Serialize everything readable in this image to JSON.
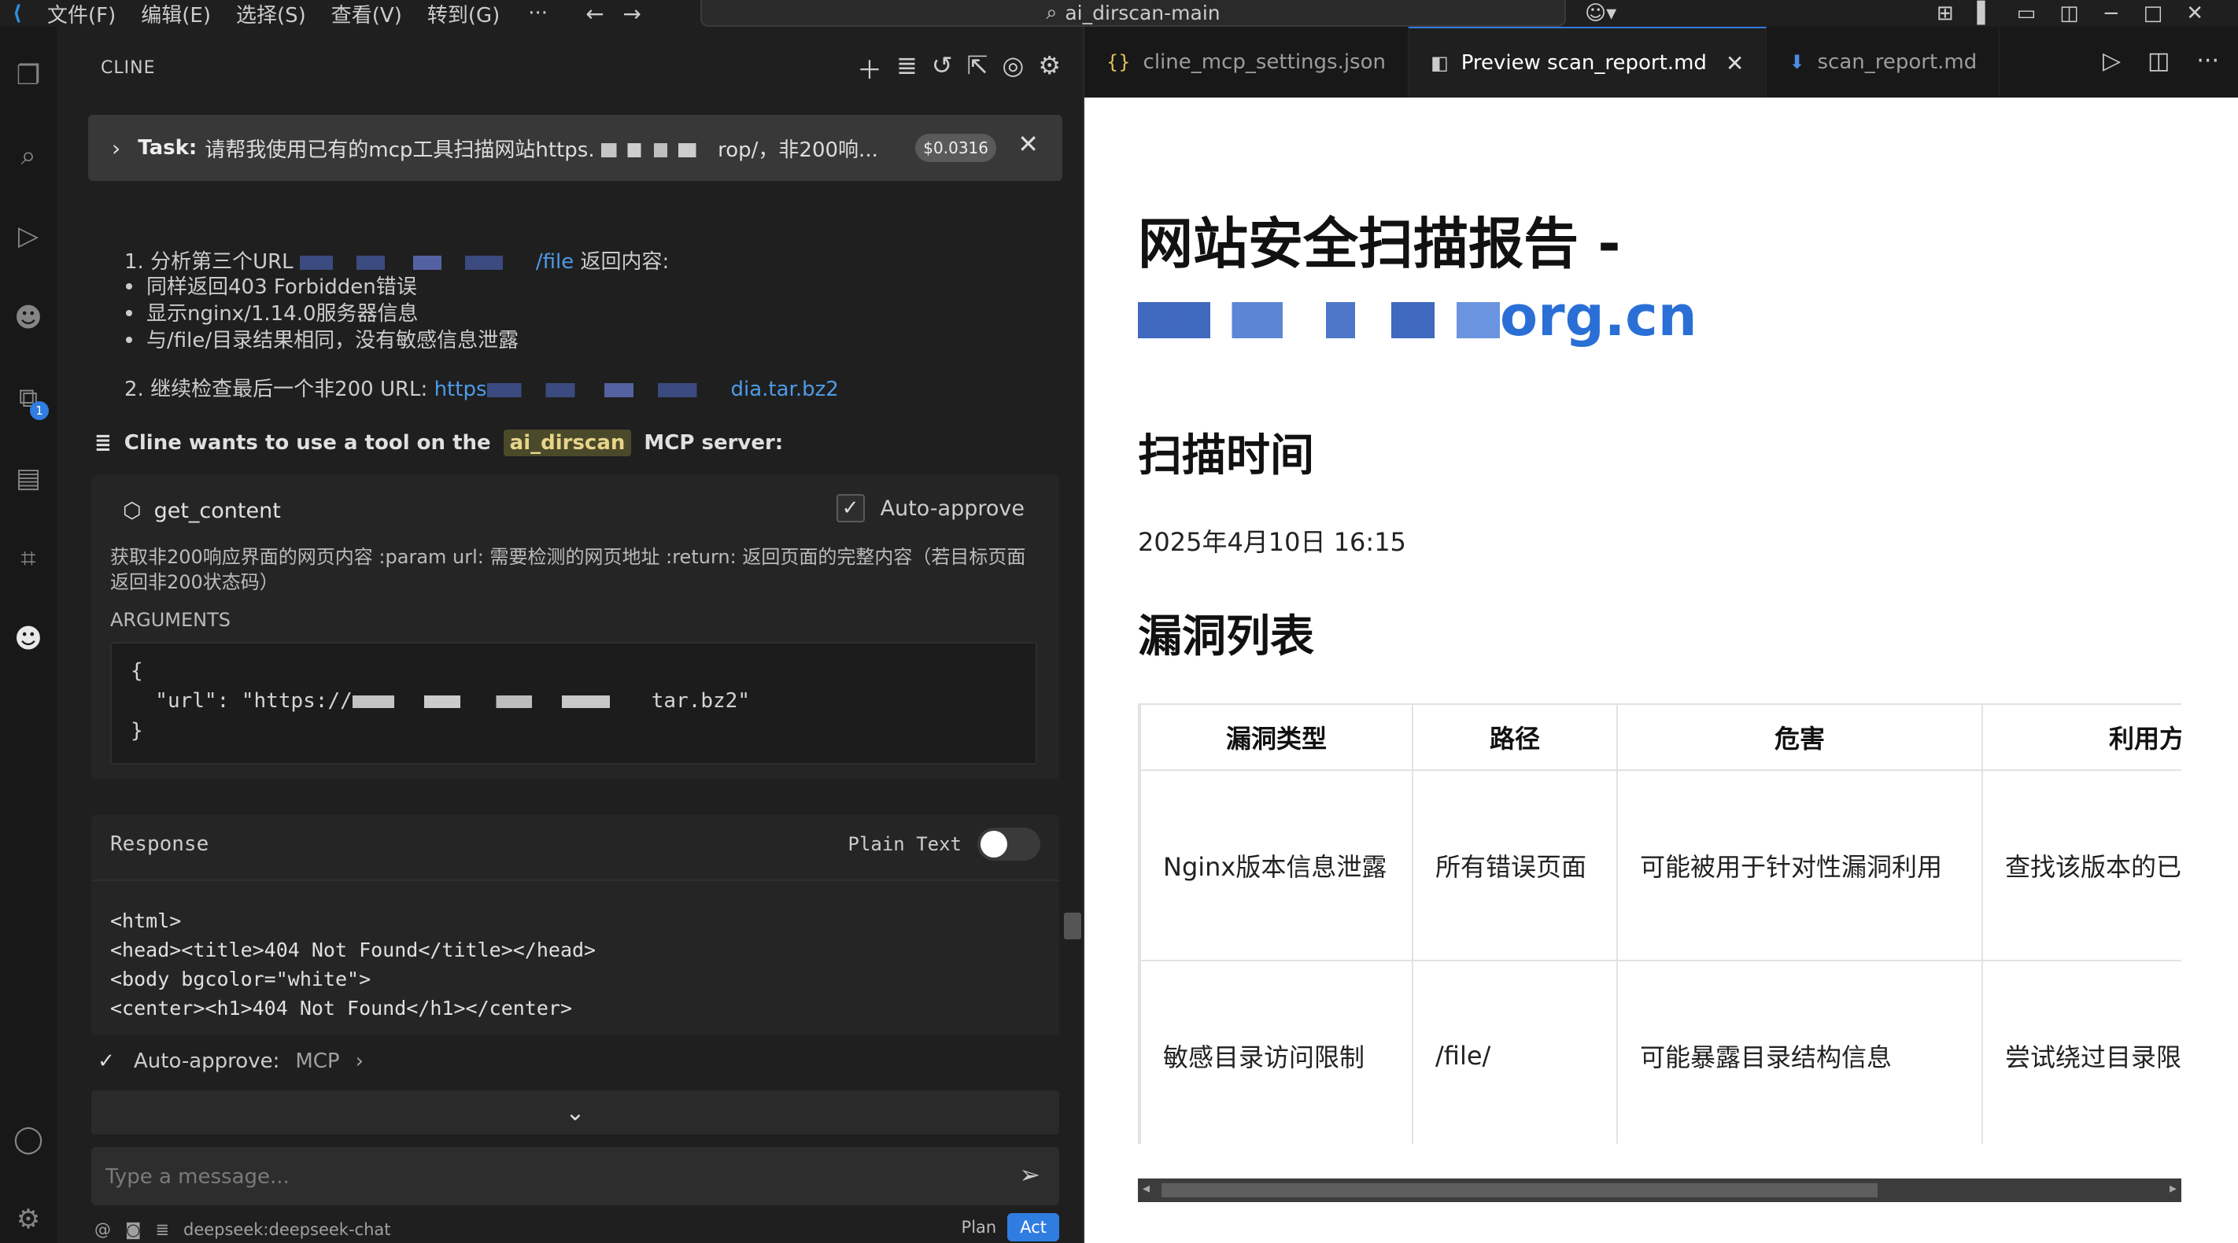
{
  "titlebar": {
    "menu": [
      "文件(F)",
      "编辑(E)",
      "选择(S)",
      "查看(V)",
      "转到(G)"
    ],
    "more": "···",
    "search_text": "ai_dirscan-main"
  },
  "activity": {
    "extensions_badge": "1"
  },
  "cline": {
    "panel_title": "CLINE",
    "task": {
      "label": "Task:",
      "text": "请帮我使用已有的mcp工具扫描网站https.",
      "text_tail": "rop/，非200响...",
      "cost": "$0.0316"
    },
    "step1": {
      "prefix": "1. 分析第三个URL",
      "link_tail": "/file",
      "suffix": "返回内容:"
    },
    "bullets": [
      "同样返回403 Forbidden错误",
      "显示nginx/1.14.0服务器信息",
      "与/file/目录结果相同，没有敏感信息泄露"
    ],
    "step2": {
      "prefix": "2. 继续检查最后一个非200 URL:",
      "link_head": "https",
      "link_tail": "dia.tar.bz2"
    },
    "mcp": {
      "prefix": "Cline wants to use a tool on the",
      "server": "ai_dirscan",
      "suffix": "MCP server:"
    },
    "tool": {
      "name": "get_content",
      "auto_approve_label": "Auto-approve",
      "description": "获取非200响应界面的网页内容 :param url: 需要检测的网页地址 :return: 返回页面的完整内容（若目标页面返回非200状态码）",
      "arguments_label": "ARGUMENTS",
      "code_open": "{",
      "code_key": "  \"url\": \"https://",
      "code_tail": "tar.bz2\"",
      "code_close": "}"
    },
    "response": {
      "label": "Response",
      "plain_text_label": "Plain Text",
      "plain_text_on": false,
      "lines": [
        "<html>",
        "<head><title>404 Not Found</title></head>",
        "<body bgcolor=\"white\">",
        "<center><h1>404 Not Found</h1></center>"
      ]
    },
    "auto_approve_row": {
      "label": "Auto-approve:",
      "value": "MCP"
    },
    "input_placeholder": "Type a message...",
    "model": "deepseek:deepseek-chat",
    "plan_label": "Plan",
    "act_label": "Act",
    "at_symbol": "@"
  },
  "editor": {
    "tabs": [
      {
        "label": "cline_mcp_settings.json",
        "active": false
      },
      {
        "label": "Preview scan_report.md",
        "active": true
      },
      {
        "label": "scan_report.md",
        "active": false
      }
    ],
    "preview": {
      "title": "网站安全扫描报告 -",
      "domain_tail": "org.cn",
      "scan_time_heading": "扫描时间",
      "scan_time": "2025年4月10日 16:15",
      "vuln_heading": "漏洞列表",
      "table": {
        "headers": [
          "漏洞类型",
          "路径",
          "危害",
          "利用方法"
        ],
        "rows": [
          [
            "Nginx版本信息泄露",
            "所有错误页面",
            "可能被用于针对性漏洞利用",
            "查找该版本的已"
          ],
          [
            "敏感目录访问限制",
            "/file/",
            "可能暴露目录结构信息",
            "尝试绕过目录限"
          ]
        ]
      }
    }
  }
}
